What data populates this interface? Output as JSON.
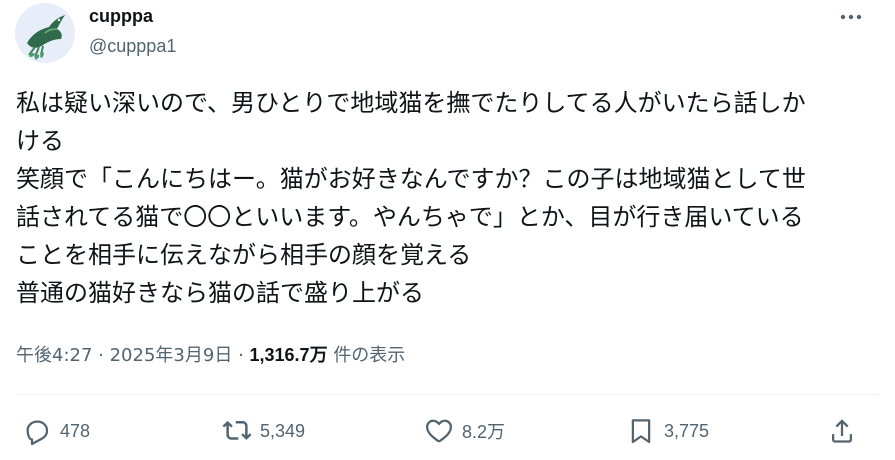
{
  "user": {
    "display_name": "cupppa",
    "handle": "@cupppa1"
  },
  "tweet": {
    "lines": [
      "私は疑い深いので、男ひとりで地域猫を撫でたりしてる人がいたら話しか",
      "ける",
      "笑顔で「こんにちはー。猫がお好きなんですか？この子は地域猫として世",
      "話されてる猫で〇〇といいます。やんちゃで」とか、目が行き届いている",
      "ことを相手に伝えながら相手の顔を覚える",
      "普通の猫好きなら猫の話で盛り上がる"
    ]
  },
  "meta": {
    "time": "午後4:27",
    "separator": "·",
    "date": "2025年3月9日",
    "views_count": "1,316.7万",
    "views_label": "件の表示"
  },
  "actions": {
    "replies": "478",
    "reposts": "5,349",
    "likes": "8.2万",
    "bookmarks": "3,775"
  },
  "colors": {
    "text": "#0f1419",
    "secondary": "#536471",
    "divider": "#eff3f4",
    "avatar_bg": "#e8eef9",
    "avatar_bird": "#2f6b4a"
  }
}
